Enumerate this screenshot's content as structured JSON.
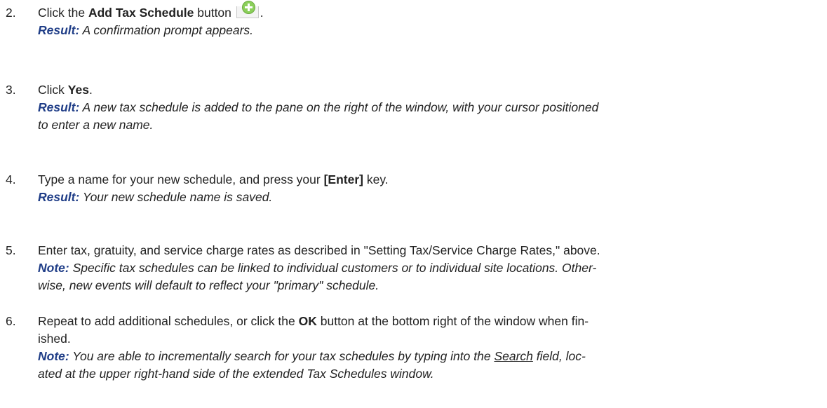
{
  "steps": [
    {
      "num": "2.",
      "text_before": "Click the ",
      "bold": "Add Tax Schedule",
      "text_after": " button",
      "trailing": ".",
      "icon": "add-plus-icon",
      "result_label": "Result:",
      "result_text": " A confirmation prompt appears."
    },
    {
      "num": "3.",
      "text_before": "Click ",
      "bold": "Yes",
      "text_after": ".",
      "result_label": "Result:",
      "result_text": " A new tax schedule is added to the pane on the right of the window, with your cursor positioned",
      "result_text_2": "to enter a new name."
    },
    {
      "num": "4.",
      "text_before": "Type a name for your new schedule, and press your ",
      "bold": "[Enter]",
      "text_after": " key.",
      "result_label": "Result:",
      "result_text": " Your new schedule name is saved."
    },
    {
      "num": "5.",
      "text": "Enter tax, gratuity, and service charge rates as described in \"Setting Tax/Service Charge Rates,\" above.",
      "note_label": "Note:",
      "note_text": " Specific tax schedules can be linked to individual customers or to individual site locations. Other-",
      "note_text_2": "wise, new events will default to reflect your \"primary\" schedule."
    },
    {
      "num": "6.",
      "text_before": "Repeat to add additional schedules, or click the ",
      "bold": "OK",
      "text_after": " button at the bottom right of the window when fin-",
      "text_2": "ished.",
      "note_label": "Note:",
      "note_text": " You are able to incrementally search for your tax schedules by typing into the ",
      "note_link": "Search",
      "note_text_after": " field, loc-",
      "note_text_2": "ated at the upper right-hand side of the extended Tax Schedules window."
    }
  ]
}
